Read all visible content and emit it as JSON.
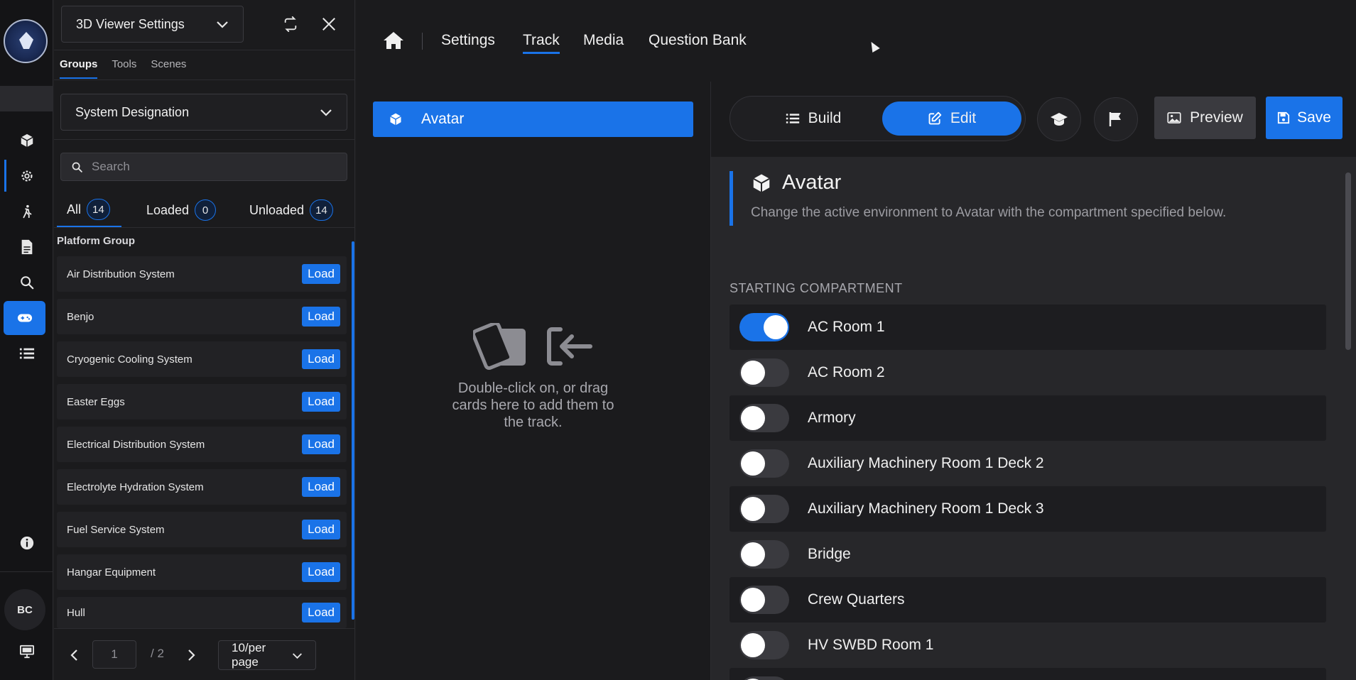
{
  "sidebar_rail": {
    "items": [
      {
        "icon": "cube-icon"
      },
      {
        "icon": "gear-icon"
      },
      {
        "icon": "walk-icon"
      },
      {
        "icon": "document-icon"
      },
      {
        "icon": "search-icon"
      },
      {
        "icon": "gamepad-icon"
      },
      {
        "icon": "list-icon"
      },
      {
        "icon": "info-icon"
      }
    ],
    "user_initials": "BC"
  },
  "panel": {
    "viewer_select": "3D Viewer Settings",
    "tabs": [
      "Groups",
      "Tools",
      "Scenes"
    ],
    "group_select": "System Designation",
    "search_placeholder": "Search",
    "filters": [
      {
        "label": "All",
        "count": "14"
      },
      {
        "label": "Loaded",
        "count": "0"
      },
      {
        "label": "Unloaded",
        "count": "14"
      }
    ],
    "group_label": "Platform Group",
    "items": [
      {
        "name": "Air Distribution System",
        "action": "Load"
      },
      {
        "name": "Benjo",
        "action": "Load"
      },
      {
        "name": "Cryogenic Cooling System",
        "action": "Load"
      },
      {
        "name": "Easter Eggs",
        "action": "Load"
      },
      {
        "name": "Electrical Distribution System",
        "action": "Load"
      },
      {
        "name": "Electrolyte Hydration System",
        "action": "Load"
      },
      {
        "name": "Fuel Service System",
        "action": "Load"
      },
      {
        "name": "Hangar Equipment",
        "action": "Load"
      },
      {
        "name": "Hull",
        "action": "Load"
      }
    ],
    "pagination": {
      "current": "1",
      "total": "/ 2",
      "per_page": "10/per page"
    }
  },
  "topnav": {
    "links": [
      "Settings",
      "Track",
      "Media",
      "Question Bank"
    ],
    "active": "Track"
  },
  "track": {
    "card_label": "Avatar",
    "empty_text": "Double-click on, or drag cards here to add them to the track."
  },
  "editor": {
    "mode_buttons": {
      "build": "Build",
      "edit": "Edit"
    },
    "preview_label": "Preview",
    "save_label": "Save",
    "title": "Avatar",
    "description": "Change the active environment to Avatar with the compartment specified below.",
    "section_label": "STARTING COMPARTMENT",
    "compartments": [
      {
        "name": "AC Room 1",
        "on": true
      },
      {
        "name": "AC Room 2",
        "on": false
      },
      {
        "name": "Armory",
        "on": false
      },
      {
        "name": "Auxiliary Machinery Room 1 Deck 2",
        "on": false
      },
      {
        "name": "Auxiliary Machinery Room 1 Deck 3",
        "on": false
      },
      {
        "name": "Bridge",
        "on": false
      },
      {
        "name": "Crew Quarters",
        "on": false
      },
      {
        "name": "HV SWBD Room 1",
        "on": false
      }
    ]
  },
  "colors": {
    "accent": "#1a73e8",
    "background": "#1e1e20",
    "panel": "#1b1b1d"
  }
}
